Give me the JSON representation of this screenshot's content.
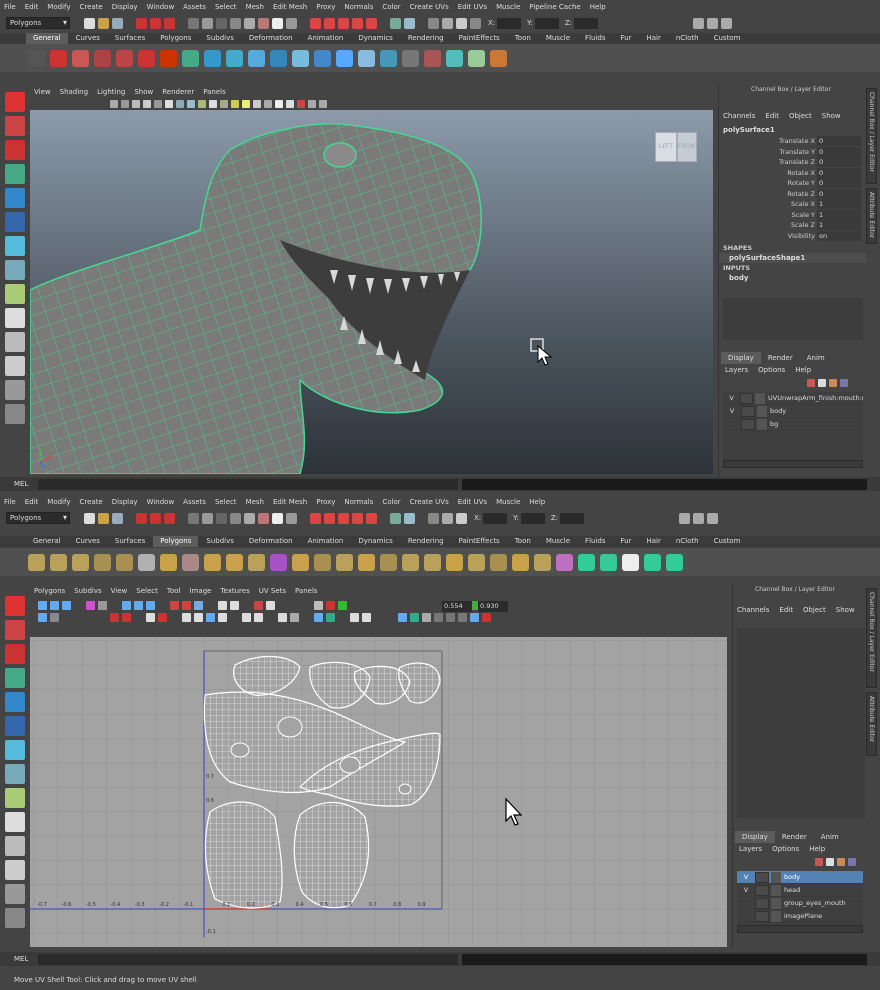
{
  "top": {
    "menus": [
      "File",
      "Edit",
      "Modify",
      "Create",
      "Display",
      "Window",
      "Assets",
      "Select",
      "Mesh",
      "Edit Mesh",
      "Proxy",
      "Normals",
      "Color",
      "Create UVs",
      "Edit UVs",
      "Muscle",
      "Pipeline Cache",
      "Help"
    ],
    "mode_dropdown": "Polygons",
    "coord_labels": [
      "X:",
      "Y:",
      "Z:"
    ],
    "shelf_tabs": [
      "General",
      "Curves",
      "Surfaces",
      "Polygons",
      "Subdivs",
      "Deformation",
      "Animation",
      "Dynamics",
      "Rendering",
      "PaintEffects",
      "Toon",
      "Muscle",
      "Fluids",
      "Fur",
      "Hair",
      "nCloth",
      "Custom"
    ],
    "active_shelf": "General",
    "panel_menus": [
      "View",
      "Shading",
      "Lighting",
      "Show",
      "Renderer",
      "Panels"
    ],
    "viewcube": {
      "left": "LEFT",
      "front": "FRONT"
    },
    "channel_box": {
      "title": "Channel Box / Layer Editor",
      "menus": [
        "Channels",
        "Edit",
        "Object",
        "Show"
      ],
      "object": "polySurface1",
      "attributes": [
        {
          "label": "Translate X",
          "value": "0"
        },
        {
          "label": "Translate Y",
          "value": "0"
        },
        {
          "label": "Translate Z",
          "value": "0"
        },
        {
          "label": "Rotate X",
          "value": "0"
        },
        {
          "label": "Rotate Y",
          "value": "0"
        },
        {
          "label": "Rotate Z",
          "value": "0"
        },
        {
          "label": "Scale X",
          "value": "1"
        },
        {
          "label": "Scale Y",
          "value": "1"
        },
        {
          "label": "Scale Z",
          "value": "1"
        },
        {
          "label": "Visibility",
          "value": "on"
        }
      ],
      "shapes_header": "SHAPES",
      "shape": "polySurfaceShape1",
      "inputs_header": "INPUTS",
      "input": "body"
    },
    "layer_tabs": [
      "Display",
      "Render",
      "Anim"
    ],
    "layer_menus": [
      "Layers",
      "Options",
      "Help"
    ],
    "layers": [
      {
        "v": "V",
        "name": "UVUnwrapArm_finish:mouth:m"
      },
      {
        "v": "V",
        "name": "body"
      },
      {
        "v": "",
        "name": "bg"
      }
    ],
    "side_tabs": [
      "Channel Box / Layer Editor",
      "Attribute Editor"
    ],
    "mel_label": "MEL"
  },
  "bottom": {
    "menus": [
      "File",
      "Edit",
      "Modify",
      "Create",
      "Display",
      "Window",
      "Assets",
      "Select",
      "Mesh",
      "Edit Mesh",
      "Proxy",
      "Normals",
      "Color",
      "Create UVs",
      "Edit UVs",
      "Muscle",
      "Help"
    ],
    "mode_dropdown": "Polygons",
    "coord_labels": [
      "X:",
      "Y:",
      "Z:"
    ],
    "shelf_tabs": [
      "General",
      "Curves",
      "Surfaces",
      "Polygons",
      "Subdivs",
      "Deformation",
      "Animation",
      "Dynamics",
      "Rendering",
      "PaintEffects",
      "Toon",
      "Muscle",
      "Fluids",
      "Fur",
      "Hair",
      "nCloth",
      "Custom"
    ],
    "active_shelf": "Polygons",
    "uv_menus": [
      "Polygons",
      "Subdivs",
      "View",
      "Select",
      "Tool",
      "Image",
      "Textures",
      "UV Sets",
      "Panels"
    ],
    "uv_fields": [
      "0.554",
      "0.930"
    ],
    "uv_axis_labels_neg": [
      "-0.7",
      "-0.6",
      "-0.5",
      "-0.4",
      "-0.3",
      "-0.2",
      "-0.1"
    ],
    "uv_axis_labels_pos": [
      "0.1",
      "0.2",
      "0.3",
      "0.4",
      "0.5",
      "0.6",
      "0.7",
      "0.8",
      "0.9"
    ],
    "uv_vert_labels": [
      "0.7",
      "0.6",
      "-0.1"
    ],
    "channel_box": {
      "title": "Channel Box / Layer Editor",
      "menus": [
        "Channels",
        "Edit",
        "Object",
        "Show"
      ]
    },
    "layer_tabs": [
      "Display",
      "Render",
      "Anim"
    ],
    "layer_menus": [
      "Layers",
      "Options",
      "Help"
    ],
    "layers": [
      {
        "v": "V",
        "name": "body",
        "selected": true
      },
      {
        "v": "V",
        "name": "head",
        "selected": false
      },
      {
        "v": "",
        "name": "group_eyes_mouth",
        "selected": false
      },
      {
        "v": "",
        "name": "imagePlane",
        "selected": false
      }
    ],
    "side_tabs": [
      "Channel Box / Layer Editor",
      "Attribute Editor"
    ],
    "mel_label": "MEL",
    "help_line": "Move UV Shell Tool: Click and drag to move UV shell"
  },
  "colors": {
    "wire": "#3ee08f",
    "uv_wire": "#ffffff",
    "selected_layer": "#5383b5",
    "active_tab": "#5d5d5d"
  }
}
